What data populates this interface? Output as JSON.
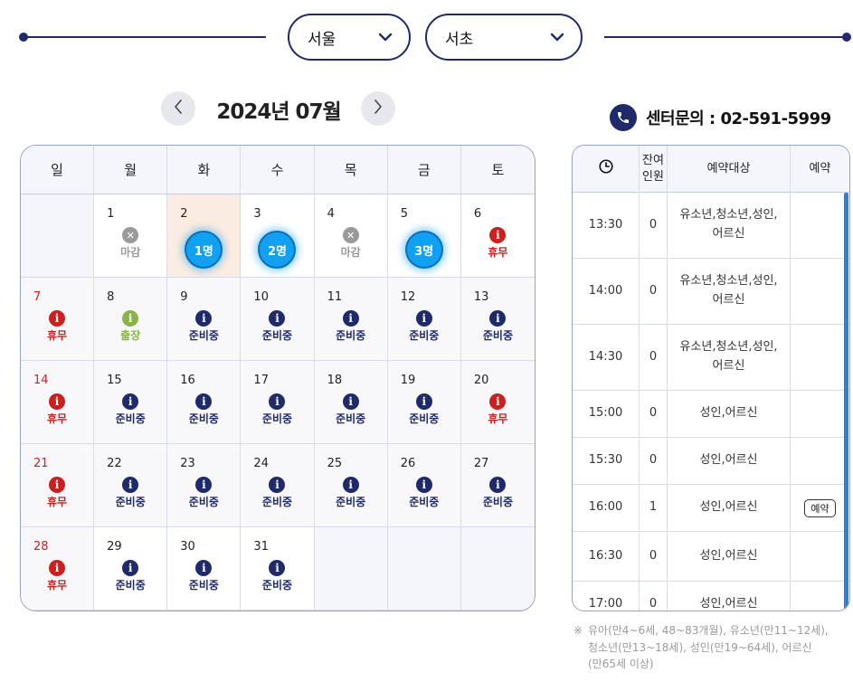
{
  "selectors": {
    "city": "서울",
    "district": "서초"
  },
  "month_nav": {
    "title": "2024년 07월"
  },
  "calendar": {
    "weekdays": [
      "일",
      "월",
      "화",
      "수",
      "목",
      "금",
      "토"
    ],
    "status_labels": {
      "closed": "마감",
      "holiday": "휴무",
      "trip": "출장",
      "preparing": "준비중"
    },
    "days": [
      {
        "day": ""
      },
      {
        "day": "1",
        "status": "closed",
        "label": "마감"
      },
      {
        "day": "2",
        "status": "available",
        "label": "1명",
        "today": true
      },
      {
        "day": "3",
        "status": "available",
        "label": "2명"
      },
      {
        "day": "4",
        "status": "closed",
        "label": "마감"
      },
      {
        "day": "5",
        "status": "available",
        "label": "3명"
      },
      {
        "day": "6",
        "status": "holiday",
        "label": "휴무"
      },
      {
        "day": "7",
        "status": "holiday",
        "label": "휴무",
        "red": true
      },
      {
        "day": "8",
        "status": "trip",
        "label": "출장"
      },
      {
        "day": "9",
        "status": "preparing",
        "label": "준비중"
      },
      {
        "day": "10",
        "status": "preparing",
        "label": "준비중"
      },
      {
        "day": "11",
        "status": "preparing",
        "label": "준비중"
      },
      {
        "day": "12",
        "status": "preparing",
        "label": "준비중"
      },
      {
        "day": "13",
        "status": "preparing",
        "label": "준비중"
      },
      {
        "day": "14",
        "status": "holiday",
        "label": "휴무",
        "red": true
      },
      {
        "day": "15",
        "status": "preparing",
        "label": "준비중"
      },
      {
        "day": "16",
        "status": "preparing",
        "label": "준비중"
      },
      {
        "day": "17",
        "status": "preparing",
        "label": "준비중"
      },
      {
        "day": "18",
        "status": "preparing",
        "label": "준비중"
      },
      {
        "day": "19",
        "status": "preparing",
        "label": "준비중"
      },
      {
        "day": "20",
        "status": "holiday",
        "label": "휴무"
      },
      {
        "day": "21",
        "status": "holiday",
        "label": "휴무",
        "red": true
      },
      {
        "day": "22",
        "status": "preparing",
        "label": "준비중"
      },
      {
        "day": "23",
        "status": "preparing",
        "label": "준비중"
      },
      {
        "day": "24",
        "status": "preparing",
        "label": "준비중"
      },
      {
        "day": "25",
        "status": "preparing",
        "label": "준비중"
      },
      {
        "day": "26",
        "status": "preparing",
        "label": "준비중"
      },
      {
        "day": "27",
        "status": "preparing",
        "label": "준비중"
      },
      {
        "day": "28",
        "status": "holiday",
        "label": "휴무",
        "red": true
      },
      {
        "day": "29",
        "status": "preparing",
        "label": "준비중"
      },
      {
        "day": "30",
        "status": "preparing",
        "label": "준비중"
      },
      {
        "day": "31",
        "status": "preparing",
        "label": "준비중"
      },
      {
        "day": ""
      },
      {
        "day": ""
      },
      {
        "day": ""
      }
    ]
  },
  "contact": {
    "text": "센터문의 : 02-591-5999"
  },
  "timetable": {
    "headers": {
      "remaining_line1": "잔여",
      "remaining_line2": "인원",
      "target": "예약대상",
      "reserve": "예약"
    },
    "rows": [
      {
        "time": "13:30",
        "remaining": "0",
        "target_line1": "유소년,청소년,성인,",
        "target_line2": "어르신",
        "reserve": ""
      },
      {
        "time": "14:00",
        "remaining": "0",
        "target_line1": "유소년,청소년,성인,",
        "target_line2": "어르신",
        "reserve": ""
      },
      {
        "time": "14:30",
        "remaining": "0",
        "target_line1": "유소년,청소년,성인,",
        "target_line2": "어르신",
        "reserve": ""
      },
      {
        "time": "15:00",
        "remaining": "0",
        "target_line1": "성인,어르신",
        "target_line2": "",
        "reserve": ""
      },
      {
        "time": "15:30",
        "remaining": "0",
        "target_line1": "성인,어르신",
        "target_line2": "",
        "reserve": ""
      },
      {
        "time": "16:00",
        "remaining": "1",
        "target_line1": "성인,어르신",
        "target_line2": "",
        "reserve": "예약"
      },
      {
        "time": "16:30",
        "remaining": "0",
        "target_line1": "성인,어르신",
        "target_line2": "",
        "reserve": ""
      },
      {
        "time": "17:00",
        "remaining": "0",
        "target_line1": "성인,어르신",
        "target_line2": "",
        "reserve": ""
      }
    ]
  },
  "note": {
    "mark": "※",
    "line1": "유아(만4~6세, 48~83개월), 유소년(만11~12세),",
    "line2": "청소년(만13~18세), 성인(만19~64세), 어르신",
    "line3": "(만65세 이상)"
  },
  "colors": {
    "navy": "#1f2a6b",
    "holiday_red": "#cc1f1f",
    "available_blue": "#12a0f0",
    "trip_green": "#8ab34a",
    "closed_gray": "#9a9a9a",
    "today_bg": "#fbece2",
    "scrollbar": "#2f7fe0"
  },
  "icons": {
    "prev": "chevron-left-icon",
    "next": "chevron-right-icon",
    "dropdown": "chevron-down-icon",
    "phone": "phone-icon",
    "clock": "clock-icon"
  }
}
